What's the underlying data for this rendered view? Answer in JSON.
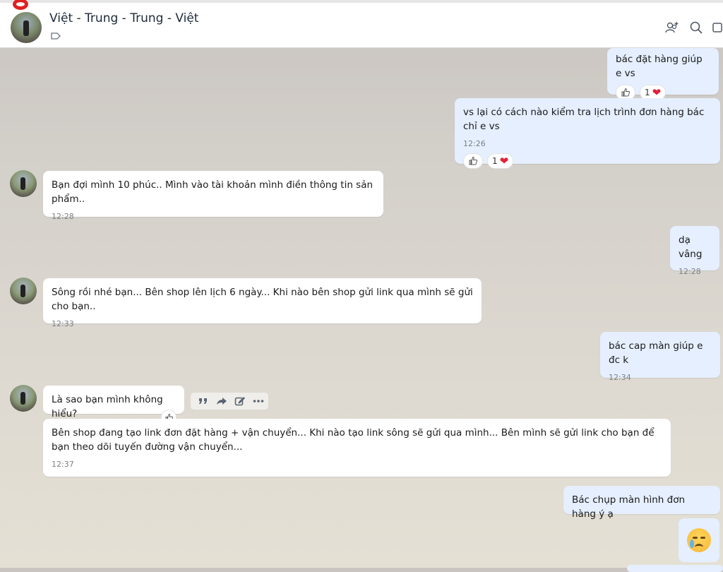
{
  "header": {
    "title": "Việt - Trung - Trung - Việt"
  },
  "messages": [
    {
      "id": "m1",
      "side": "me",
      "text": "bác đặt hàng giúp e vs",
      "time": "",
      "reaction_count": "1"
    },
    {
      "id": "m2",
      "side": "me",
      "text": "vs lại có cách nào kiểm tra lịch trình đơn hàng bác chỉ e vs",
      "time": "12:26",
      "reaction_count": "1"
    },
    {
      "id": "m3",
      "side": "other",
      "text": "Bạn đợi mình 10 phúc.. Mình vào tài khoản mình điền thông tin sản phẩm..",
      "time": "12:28"
    },
    {
      "id": "m4",
      "side": "me",
      "text": "dạ vâng",
      "time": "12:28"
    },
    {
      "id": "m5",
      "side": "other",
      "text": "Sông rồi nhé bạn... Bên shop lên lịch 6 ngày... Khi nào bên shop gửi link qua mình sẽ gửi cho bạn..",
      "time": "12:33"
    },
    {
      "id": "m6",
      "side": "me",
      "text": "bác cap màn giúp e đc k",
      "time": "12:34"
    },
    {
      "id": "m7",
      "side": "other",
      "text": "Là sao bạn mình không hiểu?",
      "time": ""
    },
    {
      "id": "m8",
      "side": "other",
      "text": "Bên shop đang tạo link đơn đặt hàng + vận chuyển... Khi nào tạo link sông sẽ gửi qua mình... Bên mình sẽ gửi link cho bạn để bạn theo dõi tuyến đường vận chuyển...",
      "time": "12:37"
    },
    {
      "id": "m9",
      "side": "me",
      "text": "Bác chụp màn hình đơn hàng ý ạ",
      "time": ""
    }
  ],
  "icons": {
    "header": [
      "add-member-icon",
      "search-icon",
      "video-call-icon"
    ],
    "hover_toolbar": [
      "quote-icon",
      "forward-icon",
      "edit-icon",
      "more-icon"
    ],
    "emoji": "crying-face-icon"
  },
  "colors": {
    "my_bubble": "#e5efff",
    "other_bubble": "#ffffff",
    "heart": "#e0243a"
  }
}
